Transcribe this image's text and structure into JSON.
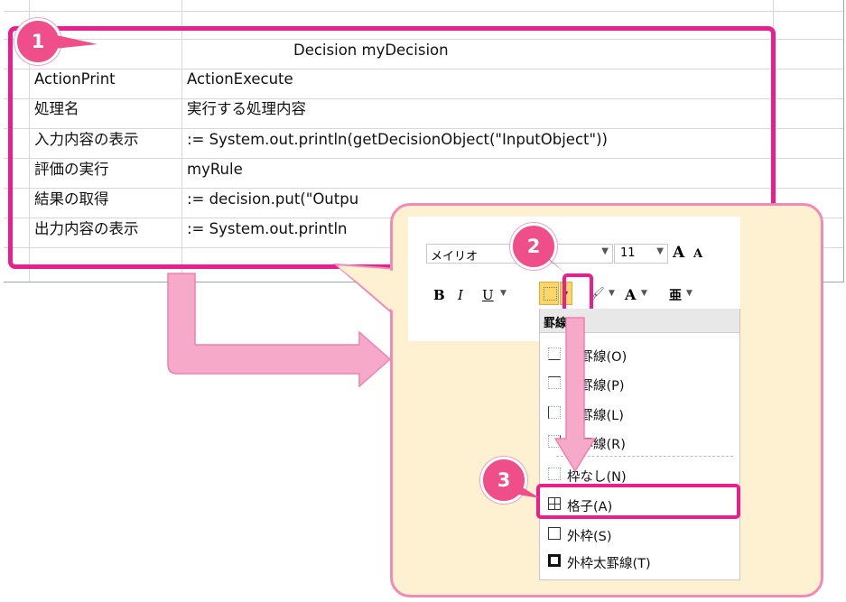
{
  "sheet": {
    "title": "Decision myDecision",
    "rows": [
      {
        "label": "ActionPrint",
        "value": "ActionExecute"
      },
      {
        "label": "処理名",
        "value": "実行する処理内容"
      },
      {
        "label": "入力内容の表示",
        "value": ":= System.out.println(getDecisionObject(\"InputObject\"))"
      },
      {
        "label": "評価の実行",
        "value": "myRule"
      },
      {
        "label": "結果の取得",
        "value": ":= decision.put(\"Outpu"
      },
      {
        "label": "出力内容の表示",
        "value": ":= System.out.println"
      }
    ]
  },
  "badges": {
    "one": "1",
    "two": "2",
    "three": "3"
  },
  "ribbon": {
    "font_name": "メイリオ",
    "font_size": "11",
    "grow_font": "A",
    "shrink_font": "A",
    "bold": "B",
    "italic": "I",
    "underline": "U",
    "font_color": "A",
    "phonetic": "亜"
  },
  "border_menu": {
    "header": "罫線",
    "items": [
      {
        "label": "下罫線(O)",
        "icon": "bottom-border-icon"
      },
      {
        "label": "上罫線(P)",
        "icon": "top-border-icon"
      },
      {
        "label": "左罫線(L)",
        "icon": "left-border-icon"
      },
      {
        "label": "右罫線(R)",
        "icon": "right-border-icon"
      },
      {
        "label": "枠なし(N)",
        "icon": "no-border-icon"
      },
      {
        "label": "格子(A)",
        "icon": "all-borders-icon"
      },
      {
        "label": "外枠(S)",
        "icon": "outside-borders-icon"
      },
      {
        "label": "外枠太罫線(T)",
        "icon": "thick-box-border-icon"
      }
    ]
  },
  "colors": {
    "highlight": "#ec1d8c",
    "badge": "#f04e88",
    "callout_bg": "#fdf1d2",
    "arrow": "#f6a9c8"
  }
}
